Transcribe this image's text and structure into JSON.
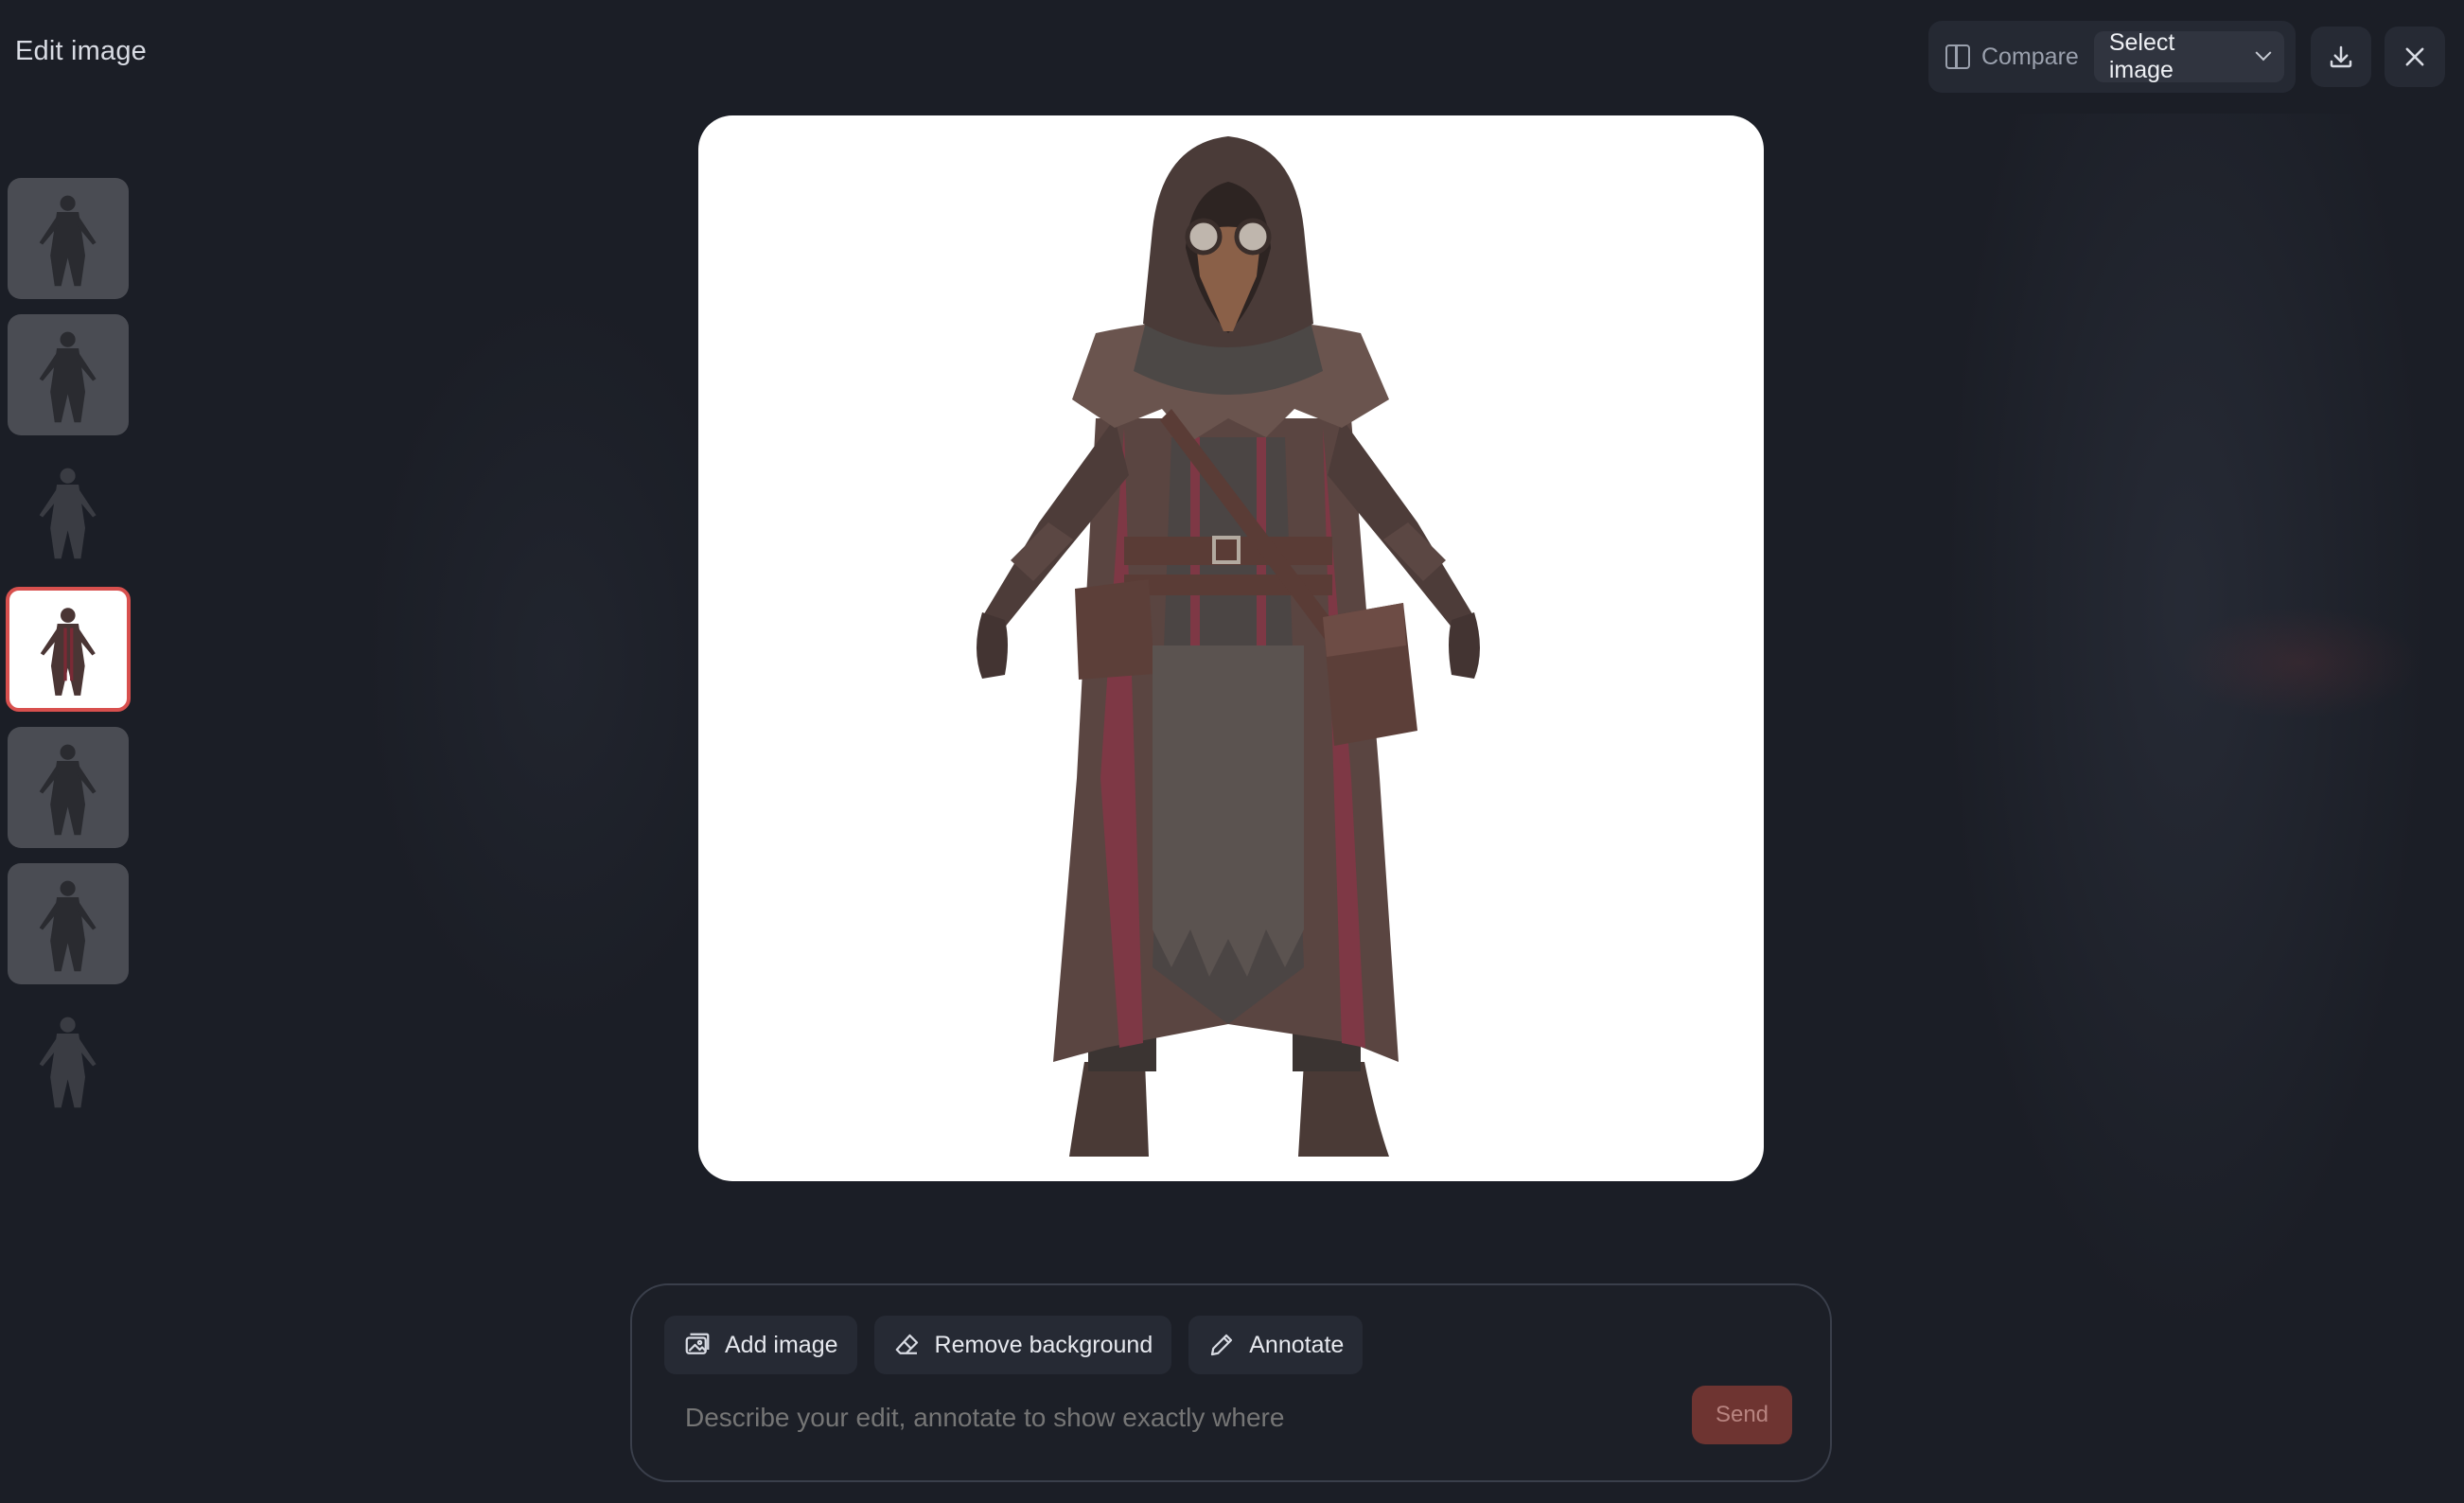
{
  "header": {
    "title": "Edit image"
  },
  "toolbar": {
    "compare_label": "Compare",
    "select_label": "Select image",
    "icons": [
      "compare-icon",
      "chevron-down-icon",
      "download-icon",
      "close-icon"
    ]
  },
  "thumbnails": {
    "count": 7,
    "selected_index": 3,
    "items": [
      "character-front-1",
      "character-front-2",
      "character-front-3",
      "character-front-4",
      "character-front-5",
      "character-front-6",
      "character-front-7"
    ]
  },
  "main_image": {
    "subject": "hooded plague doctor character"
  },
  "composer": {
    "add_image_label": "Add image",
    "remove_background_label": "Remove background",
    "annotate_label": "Annotate",
    "placeholder": "Describe your edit, annotate to show exactly where",
    "send_label": "Send"
  },
  "colors": {
    "background": "#1b1e26",
    "accent": "#d8504e",
    "send_button": "#6e3431"
  }
}
